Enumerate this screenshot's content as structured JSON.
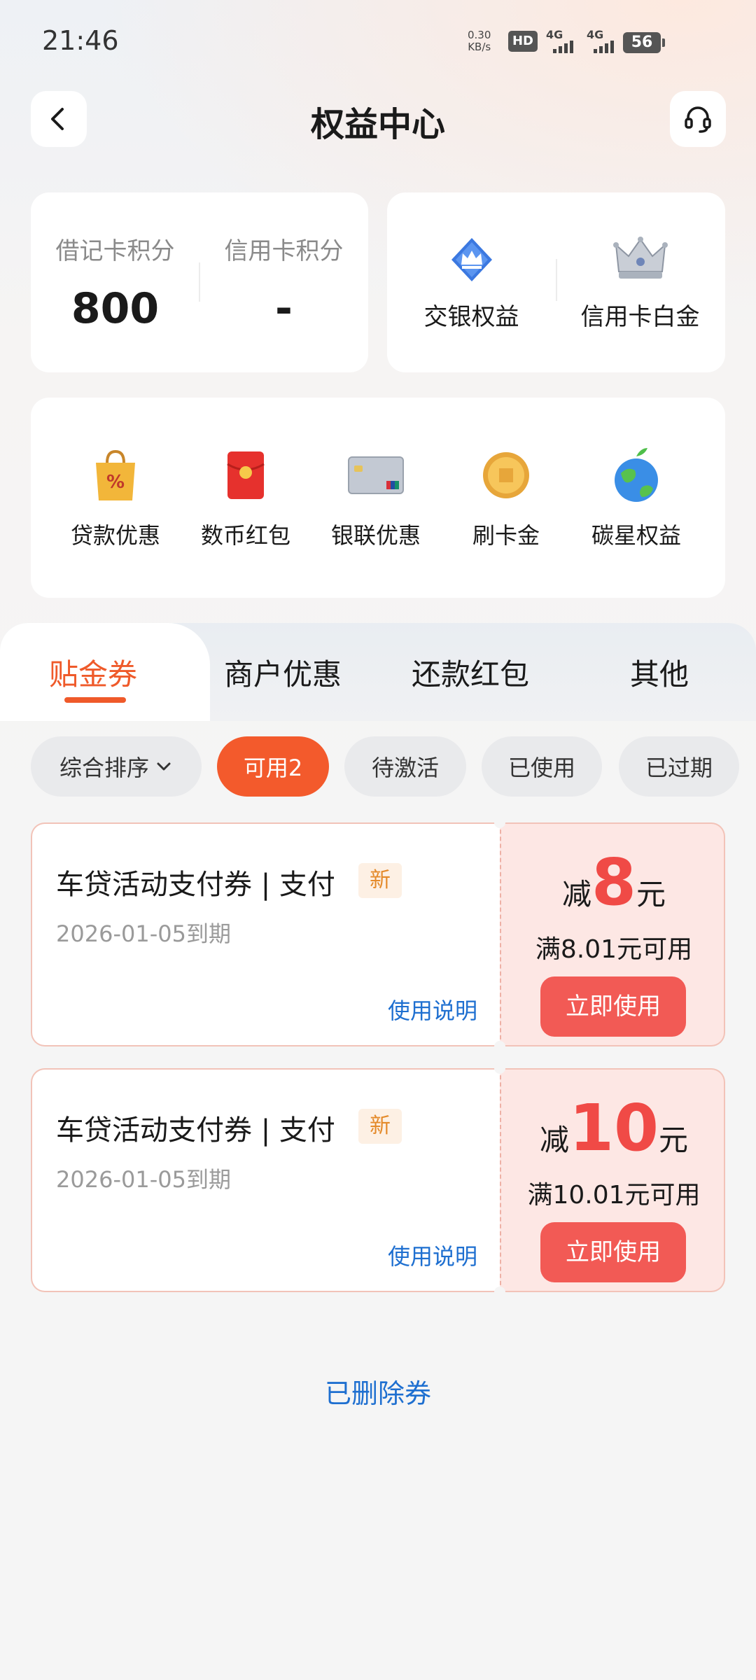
{
  "status_bar": {
    "time": "21:46",
    "net_speed_value": "0.30",
    "net_speed_unit": "KB/s",
    "hd_label": "HD",
    "signal1_label": "4G",
    "signal2_label": "4G",
    "battery": "56"
  },
  "header": {
    "title": "权益中心",
    "back_icon": "chevron-left-icon",
    "service_icon": "headset-icon"
  },
  "points": {
    "debit": {
      "label": "借记卡积分",
      "value": "800"
    },
    "credit": {
      "label": "信用卡积分",
      "value": "-"
    }
  },
  "rights": [
    {
      "label": "交银权益",
      "icon": "crown-badge-icon"
    },
    {
      "label": "信用卡白金",
      "icon": "silver-crown-icon"
    }
  ],
  "menu": [
    {
      "label": "贷款优惠",
      "icon": "discount-bag-icon"
    },
    {
      "label": "数币红包",
      "icon": "red-envelope-icon"
    },
    {
      "label": "银联优惠",
      "icon": "bank-card-icon"
    },
    {
      "label": "刷卡金",
      "icon": "gold-coin-icon"
    },
    {
      "label": "碳星权益",
      "icon": "earth-icon"
    }
  ],
  "tabs": [
    {
      "label": "贴金券",
      "active": true
    },
    {
      "label": "商户优惠",
      "active": false
    },
    {
      "label": "还款红包",
      "active": false
    },
    {
      "label": "其他",
      "active": false
    }
  ],
  "filters": [
    {
      "label": "综合排序",
      "active": false,
      "dropdown": true
    },
    {
      "label": "可用2",
      "active": true
    },
    {
      "label": "待激活",
      "active": false
    },
    {
      "label": "已使用",
      "active": false
    },
    {
      "label": "已过期",
      "active": false
    }
  ],
  "coupons": [
    {
      "name": "车贷活动支付券 | 支付",
      "tag": "新",
      "expiry": "2026-01-05到期",
      "usage_link": "使用说明",
      "amount_prefix": "减",
      "amount": "8",
      "amount_unit": "元",
      "condition": "满8.01元可用",
      "button": "立即使用"
    },
    {
      "name": "车贷活动支付券 | 支付",
      "tag": "新",
      "expiry": "2026-01-05到期",
      "usage_link": "使用说明",
      "amount_prefix": "减",
      "amount": "10",
      "amount_unit": "元",
      "condition": "满10.01元可用",
      "button": "立即使用"
    }
  ],
  "footer": {
    "deleted_link": "已删除券"
  },
  "colors": {
    "accent": "#ef5a2a",
    "coupon_red": "#f25a55",
    "link_blue": "#1e6fd0"
  }
}
